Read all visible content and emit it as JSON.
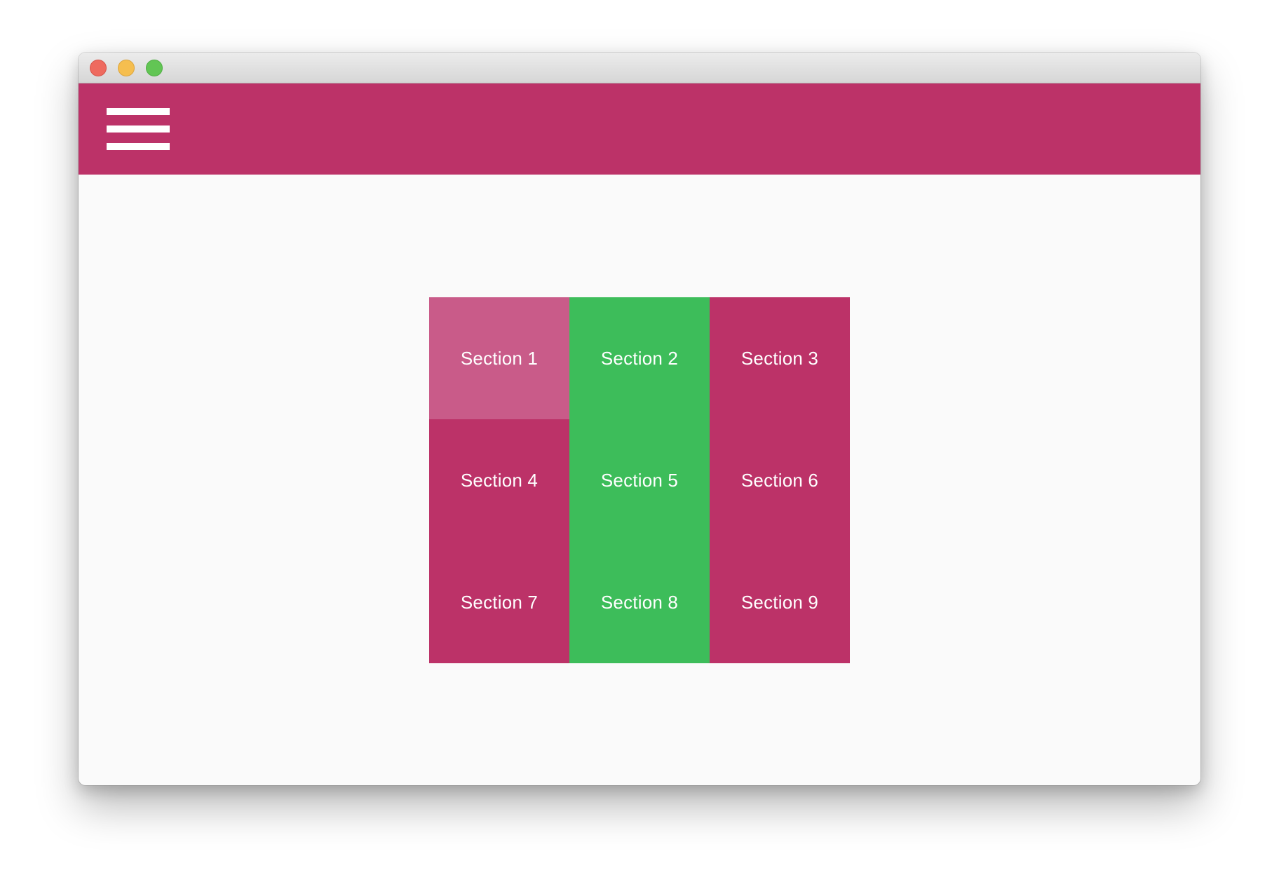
{
  "colors": {
    "accent": "#bc3268",
    "accent_light": "#c95b89",
    "green": "#3dbd5a",
    "content_bg": "#fafafa"
  },
  "appbar": {
    "menu_icon": "hamburger-menu-icon"
  },
  "sections": [
    {
      "label": "Section 1",
      "color": "pink",
      "active": true
    },
    {
      "label": "Section 2",
      "color": "green",
      "active": false
    },
    {
      "label": "Section 3",
      "color": "pink",
      "active": false
    },
    {
      "label": "Section 4",
      "color": "pink",
      "active": false
    },
    {
      "label": "Section 5",
      "color": "green",
      "active": false
    },
    {
      "label": "Section 6",
      "color": "pink",
      "active": false
    },
    {
      "label": "Section 7",
      "color": "pink",
      "active": false
    },
    {
      "label": "Section 8",
      "color": "green",
      "active": false
    },
    {
      "label": "Section 9",
      "color": "pink",
      "active": false
    }
  ]
}
